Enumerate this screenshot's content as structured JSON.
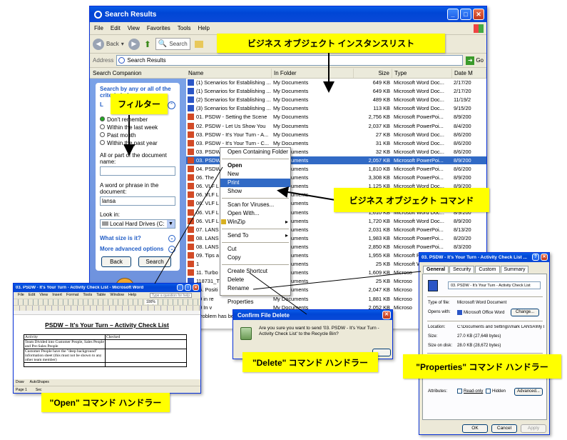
{
  "explorer": {
    "title": "Search Results",
    "menu": [
      "File",
      "Edit",
      "View",
      "Favorites",
      "Tools",
      "Help"
    ],
    "toolbar": {
      "back": "Back",
      "search": "Search"
    },
    "address_label": "Address",
    "address_value": "Search Results",
    "go_label": "Go",
    "companion_title": "Search Companion",
    "companion": {
      "heading": "Search by any or all of the criteria below.",
      "when_label": "L",
      "when_options": [
        "Don't remember",
        "Within the last week",
        "Past month",
        "Within the past year"
      ],
      "part_label": "All or part of the document name:",
      "phrase_label": "A word or phrase in the document:",
      "phrase_value": "lansa",
      "lookin_label": "Look in:",
      "lookin_value": "Local Hard Drives (C:",
      "size_label": "What size is it?",
      "advanced_label": "More advanced options",
      "back_btn": "Back",
      "search_btn": "Search"
    },
    "columns": [
      "Name",
      "In Folder",
      "Size",
      "Type",
      "Date M"
    ],
    "rows": [
      {
        "icon": "word",
        "name": "(1) Scenarios for Establishing ...",
        "folder": "My Documents",
        "size": "649 KB",
        "type": "Microsoft Word Doc...",
        "date": "2/17/20"
      },
      {
        "icon": "word",
        "name": "(1) Scenarios for Establishing ...",
        "folder": "My Documents",
        "size": "649 KB",
        "type": "Microsoft Word Doc...",
        "date": "2/17/20"
      },
      {
        "icon": "word",
        "name": "(2) Scenarios for Establishing ...",
        "folder": "My Documents",
        "size": "489 KB",
        "type": "Microsoft Word Doc...",
        "date": "11/19/2"
      },
      {
        "icon": "word",
        "name": "(3) Scenarios for Establishing ...",
        "folder": "My Documents",
        "size": "113 KB",
        "type": "Microsoft Word Doc...",
        "date": "9/15/20"
      },
      {
        "icon": "ppt",
        "name": "01. PSDW - Setting the Scene",
        "folder": "My Documents",
        "size": "2,756 KB",
        "type": "Microsoft PowerPoi...",
        "date": "8/9/200"
      },
      {
        "icon": "ppt",
        "name": "02. PSDW - Let Us Show You",
        "folder": "My Documents",
        "size": "2,037 KB",
        "type": "Microsoft PowerPoi...",
        "date": "8/4/200"
      },
      {
        "icon": "ppt",
        "name": "03. PSDW - It's Your Turn - A...",
        "folder": "My Documents",
        "size": "27 KB",
        "type": "Microsoft Word Doc...",
        "date": "8/6/200"
      },
      {
        "icon": "ppt",
        "name": "03. PSDW - It's Your Turn - C...",
        "folder": "My Documents",
        "size": "31 KB",
        "type": "Microsoft Word Doc...",
        "date": "8/6/200"
      },
      {
        "icon": "ppt",
        "name": "03. PSDW - It's Your Turn - C...",
        "folder": "My Documents",
        "size": "32 KB",
        "type": "Microsoft Word Doc...",
        "date": "8/6/200"
      },
      {
        "icon": "ppt",
        "name": "03. PSDW - It's Your Turn",
        "folder": "My Documents",
        "size": "2,057 KB",
        "type": "Microsoft PowerPoi...",
        "date": "8/9/200"
      },
      {
        "icon": "ppt",
        "name": "04. PSDW",
        "folder": "My Documents",
        "size": "1,810 KB",
        "type": "Microsoft PowerPoi...",
        "date": "8/6/200"
      },
      {
        "icon": "ppt",
        "name": "06. The .",
        "folder": "My Documents",
        "size": "3,308 KB",
        "type": "Microsoft PowerPoi...",
        "date": "8/9/200"
      },
      {
        "icon": "ppt",
        "name": "06. VLF L",
        "folder": "My Documents",
        "size": "1,125 KB",
        "type": "Microsoft Word Doc...",
        "date": "8/9/200"
      },
      {
        "icon": "ppt",
        "name": "06. VLF L",
        "folder": "My Documents",
        "size": "2,603 KB",
        "type": "Microsoft Word Doc...",
        "date": "8/10/20"
      },
      {
        "icon": "ppt",
        "name": "06. VLF L",
        "folder": "My Documents",
        "size": "1,850 KB",
        "type": "Microsoft Word Doc...",
        "date": "8/9/200"
      },
      {
        "icon": "ppt",
        "name": "06. VLF L",
        "folder": "My Documents",
        "size": "1,610 KB",
        "type": "Microsoft Word Doc...",
        "date": "8/9/200"
      },
      {
        "icon": "ppt",
        "name": "06. VLF L",
        "folder": "My Documents",
        "size": "1,720 KB",
        "type": "Microsoft Word Doc...",
        "date": "8/9/200"
      },
      {
        "icon": "ppt",
        "name": "07. LANS",
        "folder": "My Documents",
        "size": "2,031 KB",
        "type": "Microsoft PowerPoi...",
        "date": "8/13/20"
      },
      {
        "icon": "ppt",
        "name": "08. LANS",
        "folder": "My Documents",
        "size": "1,983 KB",
        "type": "Microsoft PowerPoi...",
        "date": "8/20/20"
      },
      {
        "icon": "ppt",
        "name": "08. LANS",
        "folder": "My Documents",
        "size": "2,850 KB",
        "type": "Microsoft PowerPoi...",
        "date": "8/3/200"
      },
      {
        "icon": "ppt",
        "name": "09. Tips a",
        "folder": "My Documents",
        "size": "1,955 KB",
        "type": "Microsoft PowerPoi...",
        "date": "8/9/200"
      },
      {
        "icon": "ppt",
        "name": "1",
        "folder": "My Documents",
        "size": "25 KB",
        "type": "Microsoft Word Doc...",
        "date": "9/23/20"
      },
      {
        "icon": "ppt",
        "name": "11. Turbo",
        "folder": "My Documents",
        "size": "1,609 KB",
        "type": "Microso",
        "date": ""
      },
      {
        "icon": "word",
        "name": "118731_T",
        "folder": "My Documents",
        "size": "25 KB",
        "type": "Microso",
        "date": ""
      },
      {
        "icon": "ppt",
        "name": "15. Positi",
        "folder": "My Documents",
        "size": "2,047 KB",
        "type": "Microso",
        "date": ""
      },
      {
        "icon": "ppt",
        "name": "99 in re",
        "folder": "My Documents",
        "size": "1,881 KB",
        "type": "Microso",
        "date": ""
      },
      {
        "icon": "ppt",
        "name": "00 In v",
        "folder": "My Documents",
        "size": "2,052 KB",
        "type": "Microso",
        "date": ""
      },
      {
        "icon": "word",
        "name": "...roblem has been detected",
        "folder": "My Documents",
        "size": "",
        "type": "",
        "date": ""
      }
    ]
  },
  "context_menu": {
    "items": [
      "Open Containing Folder",
      "Open",
      "New",
      "Print",
      "Show",
      "Scan for Viruses...",
      "Open With...",
      "WinZip",
      "Send To",
      "Cut",
      "Copy",
      "Create Shortcut",
      "Delete",
      "Rename",
      "Properties"
    ]
  },
  "callouts": {
    "instance_list": "ビジネス オブジェクト インスタンスリスト",
    "filter": "フィルター",
    "commands": "ビジネス オブジェクト コマンド",
    "open_handler": "\"Open\" コマンド ハンドラー",
    "delete_handler": "\"Delete\" コマンド ハンドラー",
    "properties_handler": "\"Properties\" コマンド ハンドラー"
  },
  "word": {
    "title": "03. PSDW - It's Your Turn - Activity Check List - Microsoft Word",
    "menu": [
      "File",
      "Edit",
      "View",
      "Insert",
      "Format",
      "Tools",
      "Table",
      "Window",
      "Help"
    ],
    "help_box": "Type a question for help",
    "zoom": "100%",
    "doc_title": "PSDW – It's Your Turn – Activity Check List",
    "table_headers": [
      "Activity",
      "Checked"
    ],
    "table_rows": [
      "Team Divided into Customer People, Sales People and Pre-Sales People",
      "Customer People have the \"deep background\" information sheet (this must not be shown to any other team member)"
    ],
    "status": [
      "Page 1",
      "Sec"
    ],
    "drawing": "Draw",
    "autoshapes": "AutoShapes"
  },
  "confirm": {
    "title": "Confirm File Delete",
    "message": "Are you sure you want to send '03. PSDW - It's Your Turn - Activity Check List' to the Recycle Bin?"
  },
  "properties": {
    "title": "03. PSDW - It's Your Turn - Activity Check List ...",
    "tabs": [
      "General",
      "Security",
      "Custom",
      "Summary"
    ],
    "filename": "03. PSDW - It's Your Turn - Activity Check List",
    "type_label": "Type of file:",
    "type_value": "Microsoft Word Document",
    "opens_label": "Opens with:",
    "opens_value": "Microsoft Office Word",
    "change_btn": "Change...",
    "location_label": "Location:",
    "location_value": "C:\\Documents and Settings\\mark LANSA\\My Docu",
    "size_label": "Size:",
    "size_value": "27.0 KB (27,648 bytes)",
    "disk_label": "Size on disk:",
    "disk_value": "28.0 KB (28,672 bytes)",
    "attributes_label": "Attributes:",
    "readonly": "Read-only",
    "hidden": "Hidden",
    "advanced_btn": "Advanced...",
    "ok": "OK",
    "cancel": "Cancel",
    "apply": "Apply"
  }
}
